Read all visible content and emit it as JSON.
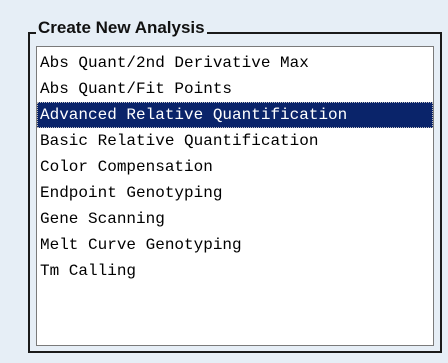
{
  "group": {
    "title": "Create New Analysis"
  },
  "analysis_list": {
    "selected_index": 2,
    "items": [
      {
        "label": "Abs Quant/2nd Derivative Max"
      },
      {
        "label": "Abs Quant/Fit Points"
      },
      {
        "label": "Advanced Relative Quantification"
      },
      {
        "label": "Basic Relative Quantification"
      },
      {
        "label": "Color Compensation"
      },
      {
        "label": "Endpoint Genotyping"
      },
      {
        "label": "Gene Scanning"
      },
      {
        "label": "Melt Curve Genotyping"
      },
      {
        "label": "Tm Calling"
      }
    ]
  },
  "colors": {
    "background": "#e6eef6",
    "selection": "#0a246a",
    "list_background": "#ffffff"
  }
}
